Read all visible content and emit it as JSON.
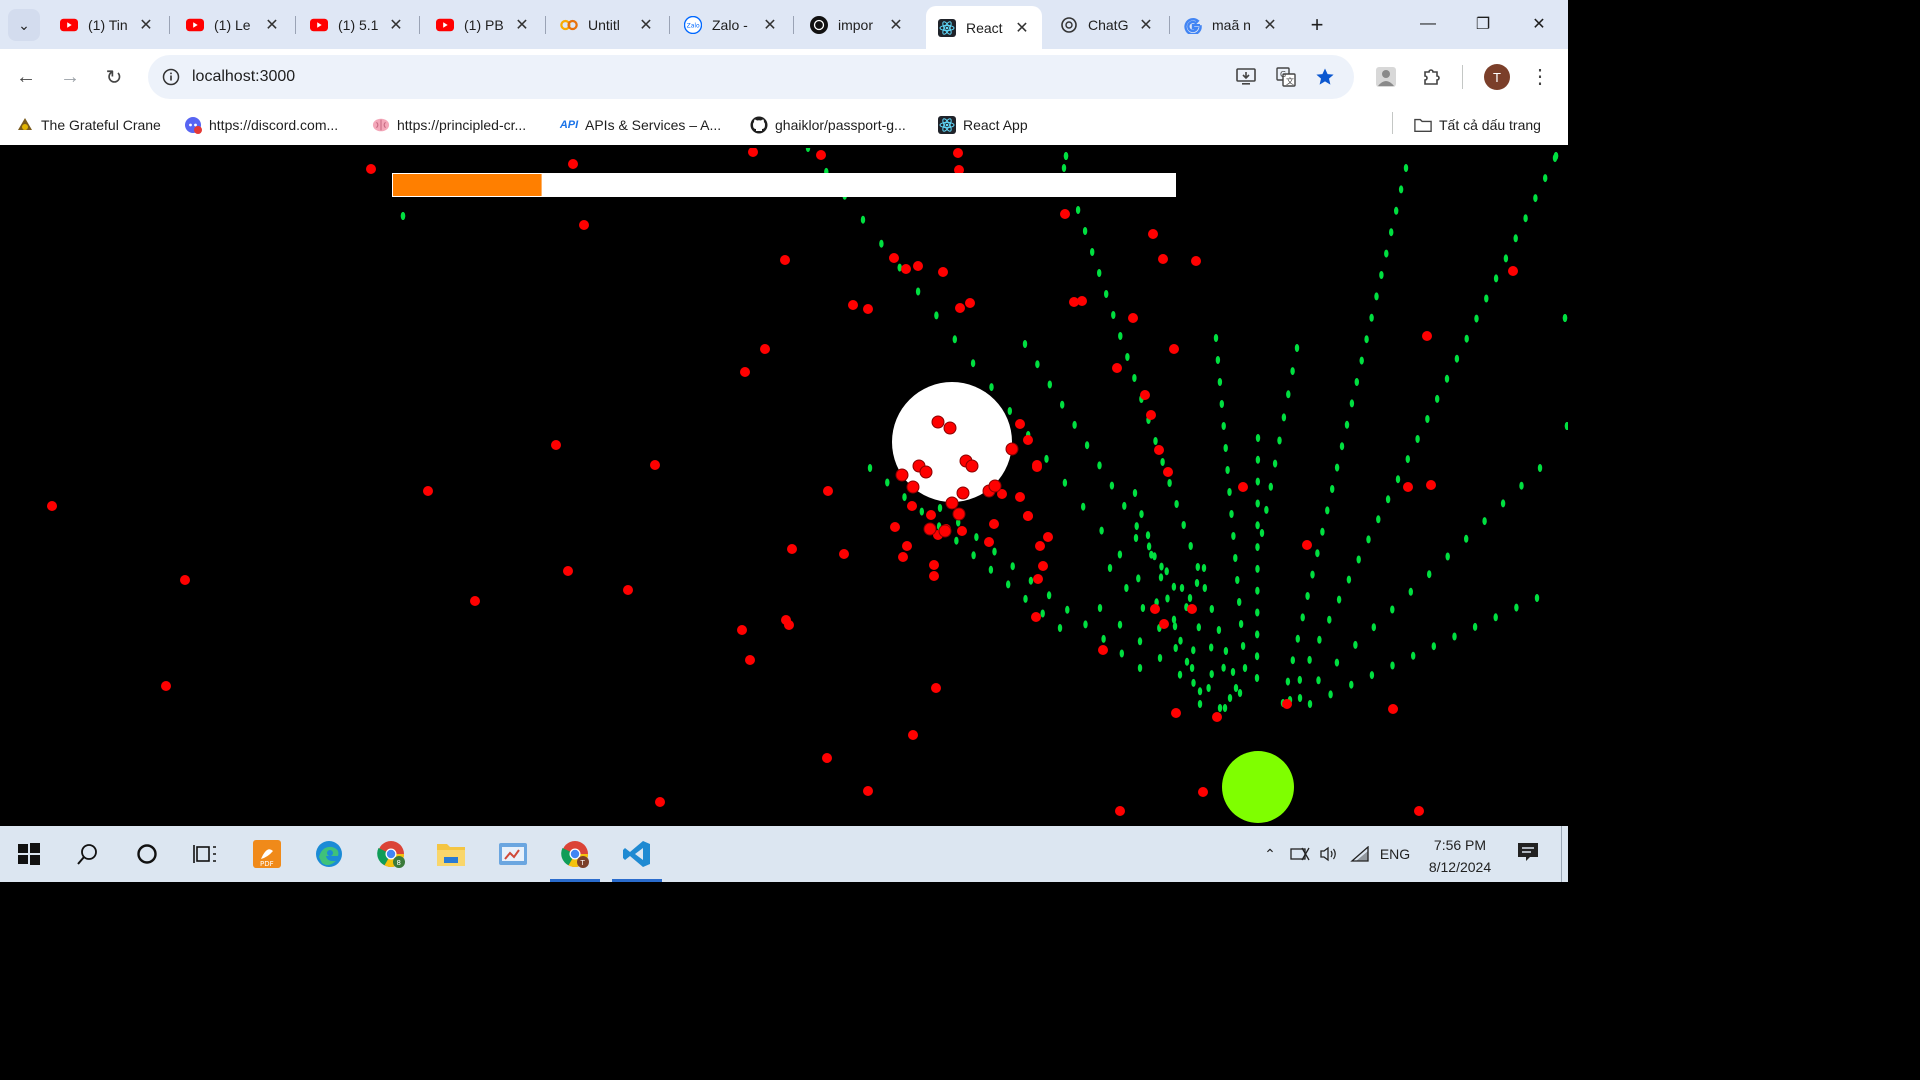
{
  "browser": {
    "tabs": [
      {
        "title": "(1) Tin",
        "icon": "youtube-icon",
        "active": false
      },
      {
        "title": "(1) Le",
        "icon": "youtube-icon",
        "active": false
      },
      {
        "title": "(1) 5.1",
        "icon": "youtube-icon",
        "active": false
      },
      {
        "title": "(1) PB",
        "icon": "youtube-icon",
        "active": false
      },
      {
        "title": "Untitl",
        "icon": "colab-icon",
        "active": false
      },
      {
        "title": "Zalo -",
        "icon": "zalo-icon",
        "active": false
      },
      {
        "title": "impor",
        "icon": "openai-icon",
        "active": false
      },
      {
        "title": "React",
        "icon": "react-icon",
        "active": true
      },
      {
        "title": "ChatG",
        "icon": "chatgpt-icon",
        "active": false
      },
      {
        "title": "maã n",
        "icon": "google-icon",
        "active": false
      }
    ],
    "url": "localhost:3000",
    "bookmarks": [
      {
        "label": "The Grateful Crane",
        "icon": "crane-icon"
      },
      {
        "label": "https://discord.com...",
        "icon": "discord-icon"
      },
      {
        "label": "https://principled-cr...",
        "icon": "brain-icon"
      },
      {
        "label": "APIs & Services – A...",
        "icon": "api-icon",
        "icon_text": "API"
      },
      {
        "label": "ghaiklor/passport-g...",
        "icon": "github-icon"
      },
      {
        "label": "React App",
        "icon": "react-icon"
      }
    ],
    "all_bookmarks_label": "Tất cả dấu trang",
    "profile_initial": "T"
  },
  "game": {
    "background": "#000000",
    "progress": {
      "fraction": 0.19,
      "fill_color": "#ff7f00",
      "track_color": "#ffffff"
    },
    "boss": {
      "color": "#ffffff"
    },
    "player": {
      "color": "#7fff00"
    },
    "enemy_bullet_color": "#ff0000",
    "player_bullet_color": "#00e040"
  },
  "taskbar": {
    "apps": [
      "windows-start-icon",
      "search-icon",
      "cortana-icon",
      "task-view-icon",
      "pdf-app-icon",
      "edge-icon",
      "chrome-profile-icon",
      "file-explorer-icon",
      "control-panel-icon",
      "chrome-icon",
      "vscode-icon"
    ],
    "language": "ENG",
    "time": "7:56 PM",
    "date": "8/12/2024"
  }
}
